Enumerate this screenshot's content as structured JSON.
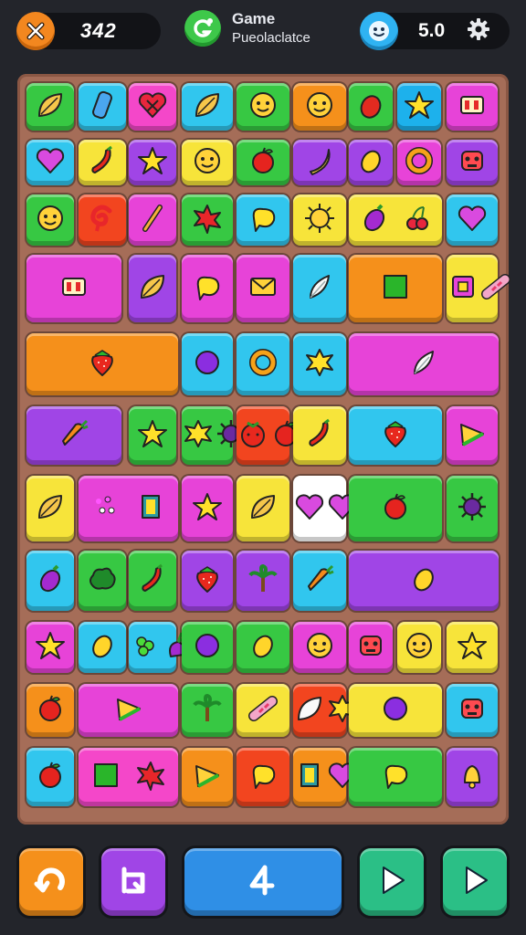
{
  "header": {
    "score": "3̶4̶2̶",
    "score_display": "342",
    "logo_title": "Game",
    "logo_subtitle": "Pueolaclatce",
    "rating": "5.0",
    "icons": [
      "close-icon",
      "logo-swirl-icon",
      "smiley-face-icon",
      "gear-icon"
    ]
  },
  "board": {
    "background": "#a56d58",
    "tiles": [
      {
        "id": "r1c1",
        "color": "#37c843",
        "icon": "leaf"
      },
      {
        "id": "r1c2",
        "color": "#31c6ee",
        "icon": "cup"
      },
      {
        "id": "r1c3",
        "color": "#f447c9",
        "icon": "heart-x"
      },
      {
        "id": "r1c4",
        "color": "#31c6ee",
        "icon": "leaf"
      },
      {
        "id": "r1c5",
        "color": "#37c843",
        "icon": "smiley"
      },
      {
        "id": "r1c6",
        "color": "#f5901b",
        "icon": "smiley"
      },
      {
        "id": "r1c7",
        "color": "#37c843",
        "icon": "berry"
      },
      {
        "id": "r1c8",
        "color": "#1db1ec",
        "icon": "star"
      },
      {
        "id": "r1c9",
        "color": "#e743d8",
        "icon": "box"
      },
      {
        "id": "r2c1",
        "color": "#31c6ee",
        "icon": "heart"
      },
      {
        "id": "r2c2",
        "color": "#f7e43a",
        "icon": "chili"
      },
      {
        "id": "r2c3",
        "color": "#a045e6",
        "icon": "star"
      },
      {
        "id": "r2c4",
        "color": "#f7e43a",
        "icon": "smiley"
      },
      {
        "id": "r2c5",
        "color": "#37c843",
        "icon": "apple"
      },
      {
        "id": "r2c6",
        "color": "#a045e6",
        "icon": "banana"
      },
      {
        "id": "r2c7",
        "color": "#a045e6",
        "icon": "lemon"
      },
      {
        "id": "r2c8",
        "color": "#e743d8",
        "icon": "ring"
      },
      {
        "id": "r2c9",
        "color": "#a045e6",
        "icon": "robot"
      },
      {
        "id": "r3c1",
        "color": "#37c843",
        "icon": "smiley"
      },
      {
        "id": "r3c2",
        "color": "#f2451f",
        "icon": "swirl"
      },
      {
        "id": "r3c3",
        "color": "#e743d8",
        "icon": "stick"
      },
      {
        "id": "r3c4",
        "color": "#37c843",
        "icon": "leaf-red"
      },
      {
        "id": "r3c5",
        "color": "#31c6ee",
        "icon": "blob"
      },
      {
        "id": "r3c6",
        "color": "#f7e43a",
        "icon": "sun"
      },
      {
        "id": "r3c7",
        "color": "#f7e43a",
        "icon": "eggplant cherry"
      },
      {
        "id": "r3c8",
        "color": "#31c6ee",
        "icon": "heart"
      },
      {
        "id": "r4c1",
        "color": "#e743d8",
        "icon": "box"
      },
      {
        "id": "r4c2",
        "color": "#a045e6",
        "icon": "leaf"
      },
      {
        "id": "r4c3",
        "color": "#e743d8",
        "icon": "blob"
      },
      {
        "id": "r4c4",
        "color": "#e743d8",
        "icon": "envelope"
      },
      {
        "id": "r4c5",
        "color": "#31c6ee",
        "icon": "feather"
      },
      {
        "id": "r4c6",
        "color": "#f5901b",
        "icon": "square"
      },
      {
        "id": "r4c7",
        "color": "#f7e43a",
        "icon": "ring-square candy"
      },
      {
        "id": "r4c8",
        "color": "#f5901b",
        "icon": "strawberry"
      },
      {
        "id": "r5c1",
        "color": "#31c6ee",
        "icon": "dot"
      },
      {
        "id": "r5c2",
        "color": "#31c6ee",
        "icon": "ring"
      },
      {
        "id": "r5c3",
        "color": "#31c6ee",
        "icon": "star-burst"
      },
      {
        "id": "r5c4",
        "color": "#e743d8",
        "icon": "feather"
      },
      {
        "id": "r5c5",
        "color": "#a045e6",
        "icon": "carrot"
      },
      {
        "id": "r5c6",
        "color": "#37c843",
        "icon": "star"
      },
      {
        "id": "r5c7",
        "color": "#37c843",
        "icon": "star-burst virus"
      },
      {
        "id": "r6c1",
        "color": "#f2451f",
        "icon": "tomato apple"
      },
      {
        "id": "r6c2",
        "color": "#f7e43a",
        "icon": "chili"
      },
      {
        "id": "r6c3",
        "color": "#31c6ee",
        "icon": "strawberry"
      },
      {
        "id": "r6c4",
        "color": "#e743d8",
        "icon": "slice"
      },
      {
        "id": "r6c5",
        "color": "#f7e43a",
        "icon": "leaf"
      },
      {
        "id": "r6c6",
        "color": "#e743d8",
        "icon": "dots card"
      },
      {
        "id": "r6c7",
        "color": "#e743d8",
        "icon": "star"
      },
      {
        "id": "r7c1",
        "color": "#f7e43a",
        "icon": "leaf"
      },
      {
        "id": "r7c2",
        "color": "#ffffff",
        "icon": "heart heart"
      },
      {
        "id": "r7c3",
        "color": "#37c843",
        "icon": "apple"
      },
      {
        "id": "r7c4",
        "color": "#37c843",
        "icon": "virus"
      },
      {
        "id": "r7c5",
        "color": "#31c6ee",
        "icon": "eggplant"
      },
      {
        "id": "r7c6",
        "color": "#37c843",
        "icon": "cloud"
      },
      {
        "id": "r7c7",
        "color": "#37c843",
        "icon": "chili"
      },
      {
        "id": "r8c1",
        "color": "#a045e6",
        "icon": "strawberry"
      },
      {
        "id": "r8c2",
        "color": "#a045e6",
        "icon": "palm"
      },
      {
        "id": "r8c3",
        "color": "#31c6ee",
        "icon": "carrot"
      },
      {
        "id": "r8c4",
        "color": "#a045e6",
        "icon": "lemon"
      },
      {
        "id": "r8c5",
        "color": "#e743d8",
        "icon": "star"
      },
      {
        "id": "r8c6",
        "color": "#31c6ee",
        "icon": "lemon"
      },
      {
        "id": "r8c7",
        "color": "#31c6ee",
        "icon": "grapes radish"
      },
      {
        "id": "r9c1",
        "color": "#37c843",
        "icon": "dot"
      },
      {
        "id": "r9c2",
        "color": "#37c843",
        "icon": "lemon"
      },
      {
        "id": "r9c3",
        "color": "#e743d8",
        "icon": "smiley"
      },
      {
        "id": "r9c4",
        "color": "#e743d8",
        "icon": "robot"
      },
      {
        "id": "r9c5",
        "color": "#f7e43a",
        "icon": "smiley"
      },
      {
        "id": "r9c6",
        "color": "#f7e43a",
        "icon": "star"
      },
      {
        "id": "r9c7",
        "color": "#f5901b",
        "icon": "apple"
      },
      {
        "id": "r9c8",
        "color": "#e743d8",
        "icon": "slice"
      },
      {
        "id": "r9c9",
        "color": "#37c843",
        "icon": "palm"
      },
      {
        "id": "r10c1",
        "color": "#f7e43a",
        "icon": "candy"
      },
      {
        "id": "r10c2",
        "color": "#f2451f",
        "icon": "leaf-white star-burst"
      },
      {
        "id": "r10c3",
        "color": "#f7e43a",
        "icon": "dot"
      },
      {
        "id": "r10c4",
        "color": "#31c6ee",
        "icon": "robot"
      },
      {
        "id": "r10c5",
        "color": "#31c6ee",
        "icon": "apple"
      },
      {
        "id": "r10c6",
        "color": "#f447c9",
        "icon": "square leaf-red"
      },
      {
        "id": "r10c7",
        "color": "#f5901b",
        "icon": "slice"
      },
      {
        "id": "r11c1",
        "color": "#f2451f",
        "icon": "blob"
      },
      {
        "id": "r11c2",
        "color": "#f5901b",
        "icon": "card heart"
      },
      {
        "id": "r11c3",
        "color": "#37c843",
        "icon": "blob"
      },
      {
        "id": "r11c4",
        "color": "#a045e6",
        "icon": "bell"
      },
      {
        "id": "r11c5",
        "color": "#f7e43a",
        "icon": "smiley"
      },
      {
        "id": "r11c6",
        "color": "#f447c9",
        "icon": "box speech"
      },
      {
        "id": "r11c7",
        "color": "#f2451f",
        "icon": "heart"
      }
    ]
  },
  "controls": {
    "buttons": [
      {
        "name": "undo-button",
        "color": "#f5901b",
        "icon": "undo-icon"
      },
      {
        "name": "shuffle-button",
        "color": "#a045e6",
        "icon": "shuffle-icon"
      },
      {
        "name": "hint-button",
        "color": "#2f8fe6",
        "icon": "hint-icon"
      },
      {
        "name": "play-button",
        "color": "#2bbf86",
        "icon": "play-icon"
      },
      {
        "name": "next-button",
        "color": "#2bbf86",
        "icon": "play-icon"
      }
    ]
  }
}
